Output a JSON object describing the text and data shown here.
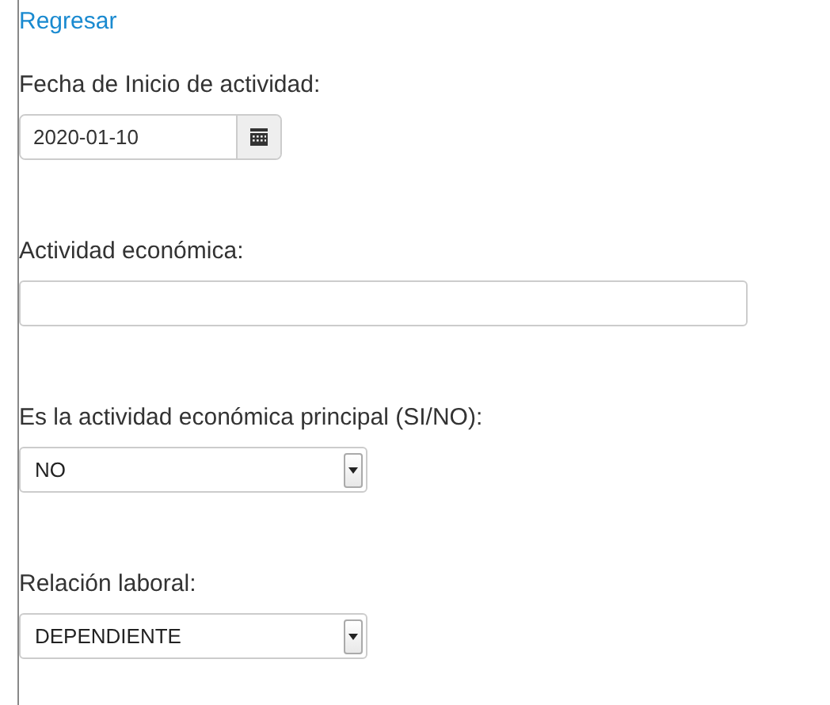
{
  "back_link": "Regresar",
  "fields": [
    {
      "kind": "date",
      "label": "Fecha de Inicio de actividad:",
      "value": "2020-01-10"
    },
    {
      "kind": "text",
      "label": "Actividad económica:"
    },
    {
      "kind": "select",
      "label": "Es la actividad económica principal (SI/NO):",
      "value": "NO"
    },
    {
      "kind": "select",
      "label": "Relación laboral:",
      "value": "DEPENDIENTE"
    }
  ]
}
